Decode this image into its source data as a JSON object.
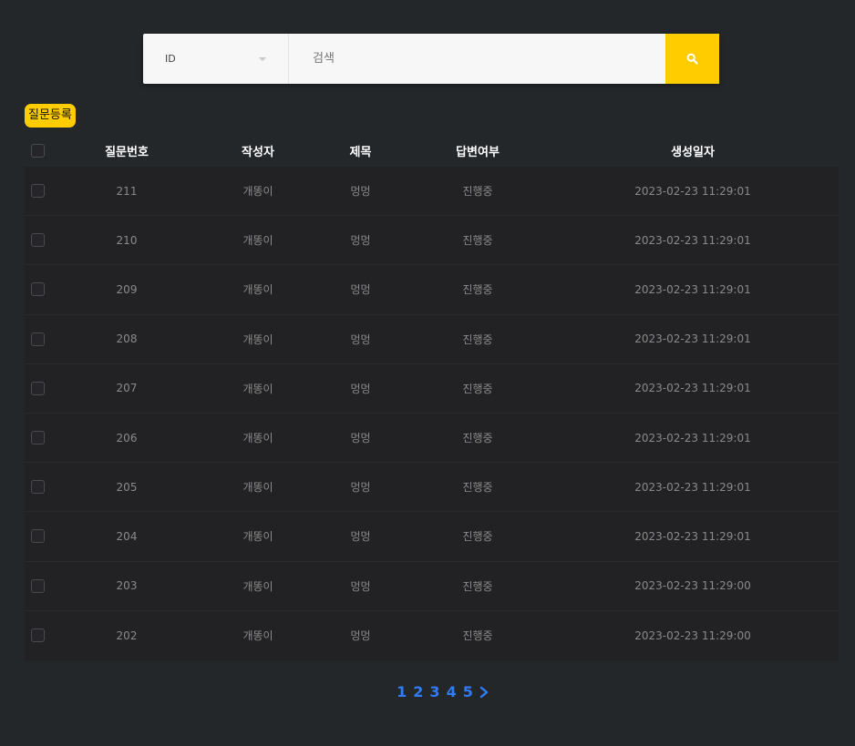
{
  "search": {
    "select_value": "ID",
    "placeholder": "검색"
  },
  "actions": {
    "register_label": "질문등록"
  },
  "table": {
    "headers": {
      "number": "질문번호",
      "author": "작성자",
      "title": "제목",
      "answer": "답변여부",
      "date": "생성일자"
    },
    "rows": [
      {
        "number": "211",
        "author": "개똥이",
        "title": "멍멍",
        "answer": "진행중",
        "date": "2023-02-23 11:29:01"
      },
      {
        "number": "210",
        "author": "개똥이",
        "title": "멍멍",
        "answer": "진행중",
        "date": "2023-02-23 11:29:01"
      },
      {
        "number": "209",
        "author": "개똥이",
        "title": "멍멍",
        "answer": "진행중",
        "date": "2023-02-23 11:29:01"
      },
      {
        "number": "208",
        "author": "개똥이",
        "title": "멍멍",
        "answer": "진행중",
        "date": "2023-02-23 11:29:01"
      },
      {
        "number": "207",
        "author": "개똥이",
        "title": "멍멍",
        "answer": "진행중",
        "date": "2023-02-23 11:29:01"
      },
      {
        "number": "206",
        "author": "개똥이",
        "title": "멍멍",
        "answer": "진행중",
        "date": "2023-02-23 11:29:01"
      },
      {
        "number": "205",
        "author": "개똥이",
        "title": "멍멍",
        "answer": "진행중",
        "date": "2023-02-23 11:29:01"
      },
      {
        "number": "204",
        "author": "개똥이",
        "title": "멍멍",
        "answer": "진행중",
        "date": "2023-02-23 11:29:01"
      },
      {
        "number": "203",
        "author": "개똥이",
        "title": "멍멍",
        "answer": "진행중",
        "date": "2023-02-23 11:29:00"
      },
      {
        "number": "202",
        "author": "개똥이",
        "title": "멍멍",
        "answer": "진행중",
        "date": "2023-02-23 11:29:00"
      }
    ]
  },
  "pagination": {
    "pages": [
      "1",
      "2",
      "3",
      "4",
      "5"
    ],
    "next_icon": "chevron-right-icon"
  },
  "colors": {
    "background": "#23272a",
    "accent": "#ffcc00",
    "page_link": "#2f7cf6"
  }
}
